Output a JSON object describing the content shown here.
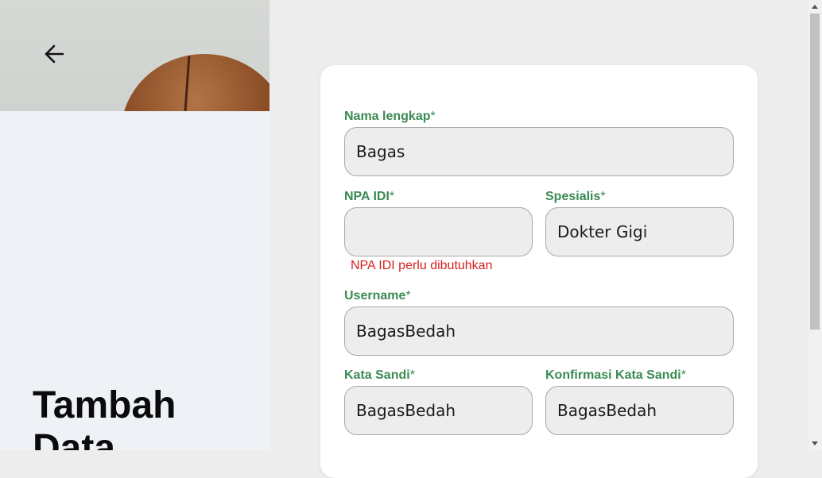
{
  "page": {
    "heading": "Tambah Data"
  },
  "form": {
    "nama": {
      "label": "Nama lengkap",
      "required_mark": "*",
      "value": "Bagas"
    },
    "npa": {
      "label": "NPA IDI",
      "required_mark": "*",
      "value": "",
      "error": "NPA IDI perlu dibutuhkan"
    },
    "spesialis": {
      "label": "Spesialis",
      "required_mark": "*",
      "value": "Dokter Gigi"
    },
    "username": {
      "label": "Username",
      "required_mark": "*",
      "value": "BagasBedah"
    },
    "kata_sandi": {
      "label": "Kata Sandi",
      "required_mark": "*",
      "value": "BagasBedah"
    },
    "konfirmasi": {
      "label": "Konfirmasi Kata Sandi",
      "required_mark": "*",
      "value": "BagasBedah"
    }
  },
  "icons": {
    "back": "arrow-left-icon"
  },
  "colors": {
    "label_green": "#3a8a52",
    "error_red": "#d61f1f",
    "input_bg": "#ededed",
    "left_panel_bg": "#eef1f6"
  }
}
